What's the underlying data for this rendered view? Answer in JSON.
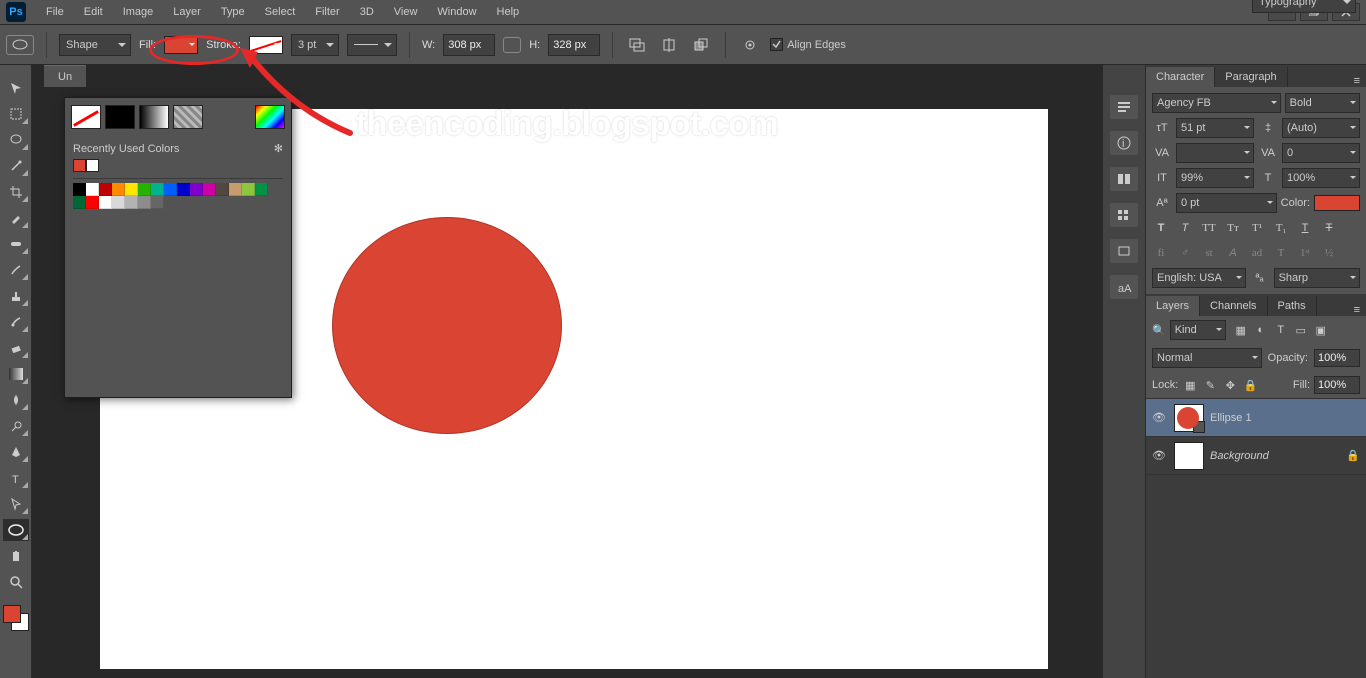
{
  "menu": {
    "items": [
      "File",
      "Edit",
      "Image",
      "Layer",
      "Type",
      "Select",
      "Filter",
      "3D",
      "View",
      "Window",
      "Help"
    ]
  },
  "options": {
    "tool_mode": "Shape",
    "fill_label": "Fill:",
    "stroke_label": "Stroke:",
    "stroke_width": "3 pt",
    "w_label": "W:",
    "w_value": "308 px",
    "h_label": "H:",
    "h_value": "328 px",
    "align_edges": "Align Edges"
  },
  "doc": {
    "tab": "Un",
    "watermark": "theencoding.blogspot.com"
  },
  "fill_popup": {
    "recently_label": "Recently Used Colors",
    "recent": [
      "#da4432",
      "#ffffff"
    ],
    "swatches_row1": [
      "#000000",
      "#ffffff",
      "#bf0000",
      "#ff8a00",
      "#ffe600",
      "#26b300",
      "#00b38c",
      "#005fff",
      "#0000cc",
      "#8000cc",
      "#cc00a3",
      "#534741",
      "#c69c6d",
      "#8cc63f",
      "#009245",
      "#006837",
      "#ff0000"
    ],
    "swatches_row2": [
      "#ffffff",
      "#d9d9d9",
      "#b3b3b3",
      "#8c8c8c",
      "#666666"
    ]
  },
  "typography_dd": "Typography",
  "character": {
    "tab_char": "Character",
    "tab_para": "Paragraph",
    "font": "Agency FB",
    "style": "Bold",
    "size": "51 pt",
    "leading": "(Auto)",
    "kerning": "",
    "tracking": "0",
    "vscale": "99%",
    "hscale": "100%",
    "baseline": "0 pt",
    "color_label": "Color:",
    "lang": "English: USA",
    "aa": "Sharp"
  },
  "layers_panel": {
    "tab_layers": "Layers",
    "tab_channels": "Channels",
    "tab_paths": "Paths",
    "filter": "Kind",
    "blend": "Normal",
    "opacity_label": "Opacity:",
    "opacity": "100%",
    "lock_label": "Lock:",
    "fill_label": "Fill:",
    "fill": "100%",
    "layers": [
      {
        "name": "Ellipse 1",
        "sel": true,
        "ellipse": true,
        "locked": false
      },
      {
        "name": "Background",
        "sel": false,
        "ellipse": false,
        "locked": true,
        "italic": true
      }
    ]
  }
}
